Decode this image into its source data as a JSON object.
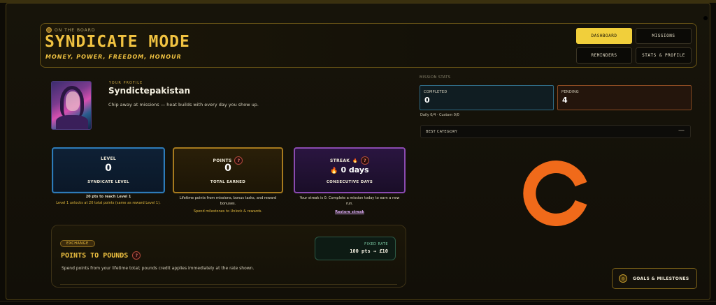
{
  "header": {
    "kicker": "ON THE BOARD",
    "title": "SYNDICATE MODE",
    "subtitle": "MONEY, POWER, FREEDOM, HONOUR"
  },
  "nav": {
    "dashboard": "DASHBOARD",
    "missions": "MISSIONS",
    "reminders": "REMINDERS",
    "stats_profile": "STATS & PROFILE",
    "active": "DASHBOARD"
  },
  "profile": {
    "kicker": "YOUR PROFILE",
    "name": "Syndictepakistan",
    "tagline": "Chip away at missions — heat builds with every day you show up."
  },
  "level_card": {
    "label": "LEVEL",
    "value": "0",
    "sub": "SYNDICATE LEVEL",
    "note1": "20 pts to reach Level 1",
    "note2": "Level 1 unlocks at 20 total points (same as reward Level 1)."
  },
  "points_card": {
    "label": "POINTS",
    "value": "0",
    "sub": "TOTAL EARNED",
    "note1": "Lifetime points from missions, bonus tasks, and reward",
    "note2": "bonuses.",
    "note3": "Spend milestones to Unlock & rewards."
  },
  "streak_card": {
    "label": "STREAK",
    "flame": "🔥",
    "value": "0 days",
    "sub": "CONSECUTIVE DAYS",
    "note1": "Your streak is 0. Complete a mission today to earn a new",
    "note2": "run.",
    "restore": "Restore streak"
  },
  "exchange": {
    "badge": "EXCHANGE",
    "title": "POINTS TO POUNDS",
    "description": "Spend points from your lifetime total; pounds credit applies immediately at the rate shown.",
    "rate_label": "FIXED RATE",
    "rate_value": "100 pts → £10"
  },
  "mission_stats": {
    "kicker": "MISSION STATS",
    "completed_label": "COMPLETED",
    "completed_value": "0",
    "pending_label": "PENDING",
    "pending_value": "4",
    "split": "Daily 0/4 · Custom 0/0",
    "best_category_label": "BEST CATEGORY",
    "best_category_toggle": "—"
  },
  "goals_button": {
    "label": "GOALS & MILESTONES",
    "icon": "target-icon"
  },
  "colors": {
    "accent": "#f0c241",
    "loader": "#f06a1a",
    "level": "#2e7bb8",
    "points": "#a67a1e",
    "streak": "#8a4ab0"
  }
}
